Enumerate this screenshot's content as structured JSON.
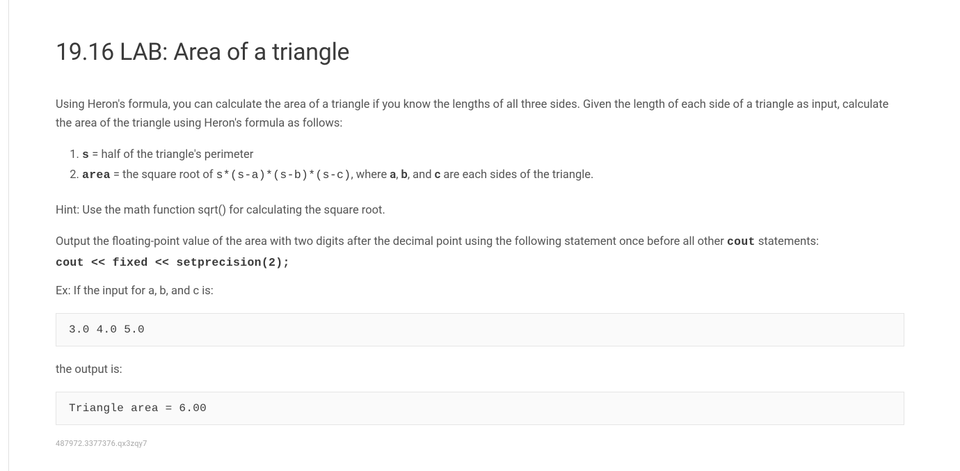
{
  "title": "19.16 LAB: Area of a triangle",
  "intro": "Using Heron's formula, you can calculate the area of a triangle if you know the lengths of all three sides. Given the length of each side of a triangle as input, calculate the area of the triangle using Heron's formula as follows:",
  "list": {
    "item1": {
      "var": "s",
      "text": " = half of the triangle's perimeter"
    },
    "item2": {
      "var": "area",
      "pre": " = the square root of ",
      "code": "s*(s-a)*(s-b)*(s-c)",
      "mid1": ", where ",
      "a": "a",
      "mid2": ", ",
      "b": "b",
      "mid3": ", and ",
      "c": "c",
      "post": " are each sides of the triangle."
    }
  },
  "hint": "Hint: Use the math function sqrt() for calculating the square root.",
  "output_instruction": {
    "pre": "Output the floating-point value of the area with two digits after the decimal point using the following statement once before all other ",
    "code": "cout",
    "post": " statements:"
  },
  "cout_statement": "cout << fixed << setprecision(2);",
  "example_label": "Ex: If the input for a, b, and c is:",
  "example_input": "3.0 4.0 5.0",
  "output_label": "the output is:",
  "example_output": "Triangle area = 6.00",
  "footer_id": "487972.3377376.qx3zqy7"
}
